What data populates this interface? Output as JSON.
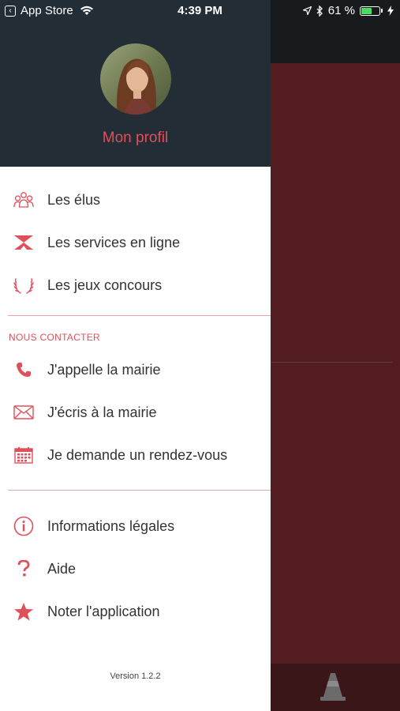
{
  "status_bar": {
    "back_app": "App Store",
    "time": "4:39 PM",
    "battery_text": "61 %",
    "battery_level": 0.61
  },
  "drawer": {
    "profile_label": "Mon profil",
    "menu_main": [
      {
        "label": "Les élus",
        "icon": "people-icon"
      },
      {
        "label": "Les services en ligne",
        "icon": "hourglass-icon"
      },
      {
        "label": "Les jeux concours",
        "icon": "laurel-icon"
      }
    ],
    "contact_section_title": "NOUS CONTACTER",
    "menu_contact": [
      {
        "label": "J'appelle la mairie",
        "icon": "phone-icon"
      },
      {
        "label": "J'écris à la mairie",
        "icon": "envelope-icon"
      },
      {
        "label": "Je demande un rendez-vous",
        "icon": "calendar-icon"
      }
    ],
    "menu_other": [
      {
        "label": "Informations légales",
        "icon": "info-icon"
      },
      {
        "label": "Aide",
        "icon": "question-icon"
      },
      {
        "label": "Noter l'application",
        "icon": "star-icon"
      }
    ],
    "version": "Version 1.2.2"
  },
  "colors": {
    "accent": "#e0505a",
    "drawer_header": "#222d35",
    "background_app": "#521c20"
  }
}
